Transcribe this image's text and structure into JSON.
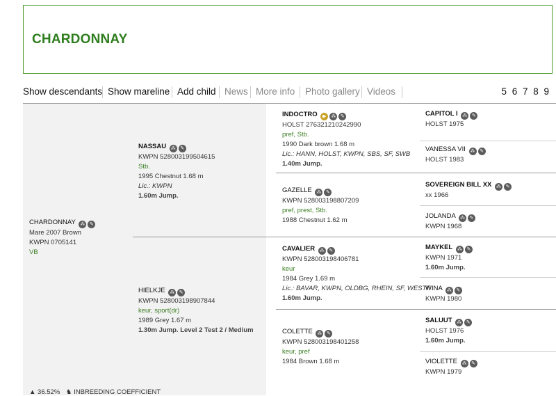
{
  "title": "CHARDONNAY",
  "nav": {
    "show_descendants": "Show descendants",
    "show_mareline": "Show mareline",
    "add_child": "Add child",
    "news": "News",
    "more_info": "More info",
    "photo_gallery": "Photo gallery",
    "videos": "Videos",
    "pages": "5 6 7 8 9"
  },
  "subject": {
    "name": "CHARDONNAY",
    "line1": "Mare 2007 Brown",
    "line2": "KWPN 0705141",
    "line3": "VB"
  },
  "sire": {
    "name": "NASSAU",
    "reg": "KWPN 528003199504615",
    "pred": "Stb.",
    "info": "1995 Chestnut 1.68 m",
    "lic": "Lic.: KWPN",
    "jump": "1.60m Jump."
  },
  "dam": {
    "name": "HIELKJE",
    "reg": "KWPN 528003198907844",
    "pred": "keur, sport(dr)",
    "info": "1989 Grey 1.67 m",
    "jump": "1.30m Jump. Level 2 Test 2 / Medium"
  },
  "ss": {
    "name": "INDOCTRO",
    "reg": "HOLST 276321210242990",
    "pred": "pref, Stb.",
    "info": "1990 Dark brown 1.68 m",
    "lic": "Lic.: HANN, HOLST, KWPN, SBS, SF, SWB",
    "jump": "1.40m Jump."
  },
  "sd": {
    "name": "GAZELLE",
    "reg": "KWPN 528003198807209",
    "pred": "pref, prest, Stb.",
    "info": "1988 Chestnut 1.62 m"
  },
  "ds": {
    "name": "CAVALIER",
    "reg": "KWPN 528003198406781",
    "pred": "keur",
    "info": "1984 Grey 1.69 m",
    "lic": "Lic.: BAVAR, KWPN, OLDBG, RHEIN, SF, WESTF",
    "jump": "1.60m Jump."
  },
  "dd": {
    "name": "COLETTE",
    "reg": "KWPN 528003198401258",
    "pred": "keur, pref",
    "info": "1984 Brown 1.68 m"
  },
  "g1": {
    "name": "CAPITOL I",
    "reg": "HOLST 1975"
  },
  "g2": {
    "name": "VANESSA VII",
    "reg": "HOLST 1983"
  },
  "g3": {
    "name": "SOVEREIGN BILL XX",
    "reg": "xx 1966"
  },
  "g4": {
    "name": "JOLANDA",
    "reg": "KWPN 1968"
  },
  "g5": {
    "name": "MAYKEL",
    "reg": "KWPN 1971",
    "jump": "1.60m Jump."
  },
  "g6": {
    "name": "WINA",
    "reg": "KWPN 1980"
  },
  "g7": {
    "name": "SALUUT",
    "reg": "HOLST 1976",
    "jump": "1.60m Jump."
  },
  "g8": {
    "name": "VIOLETTE",
    "reg": "KWPN 1979"
  },
  "footer": {
    "pct": "36.52%",
    "label": "INBREEDING COEFFICIENT"
  },
  "icons": [
    "pedigree-icon",
    "edit-icon",
    "video-icon",
    "horse-icon"
  ]
}
